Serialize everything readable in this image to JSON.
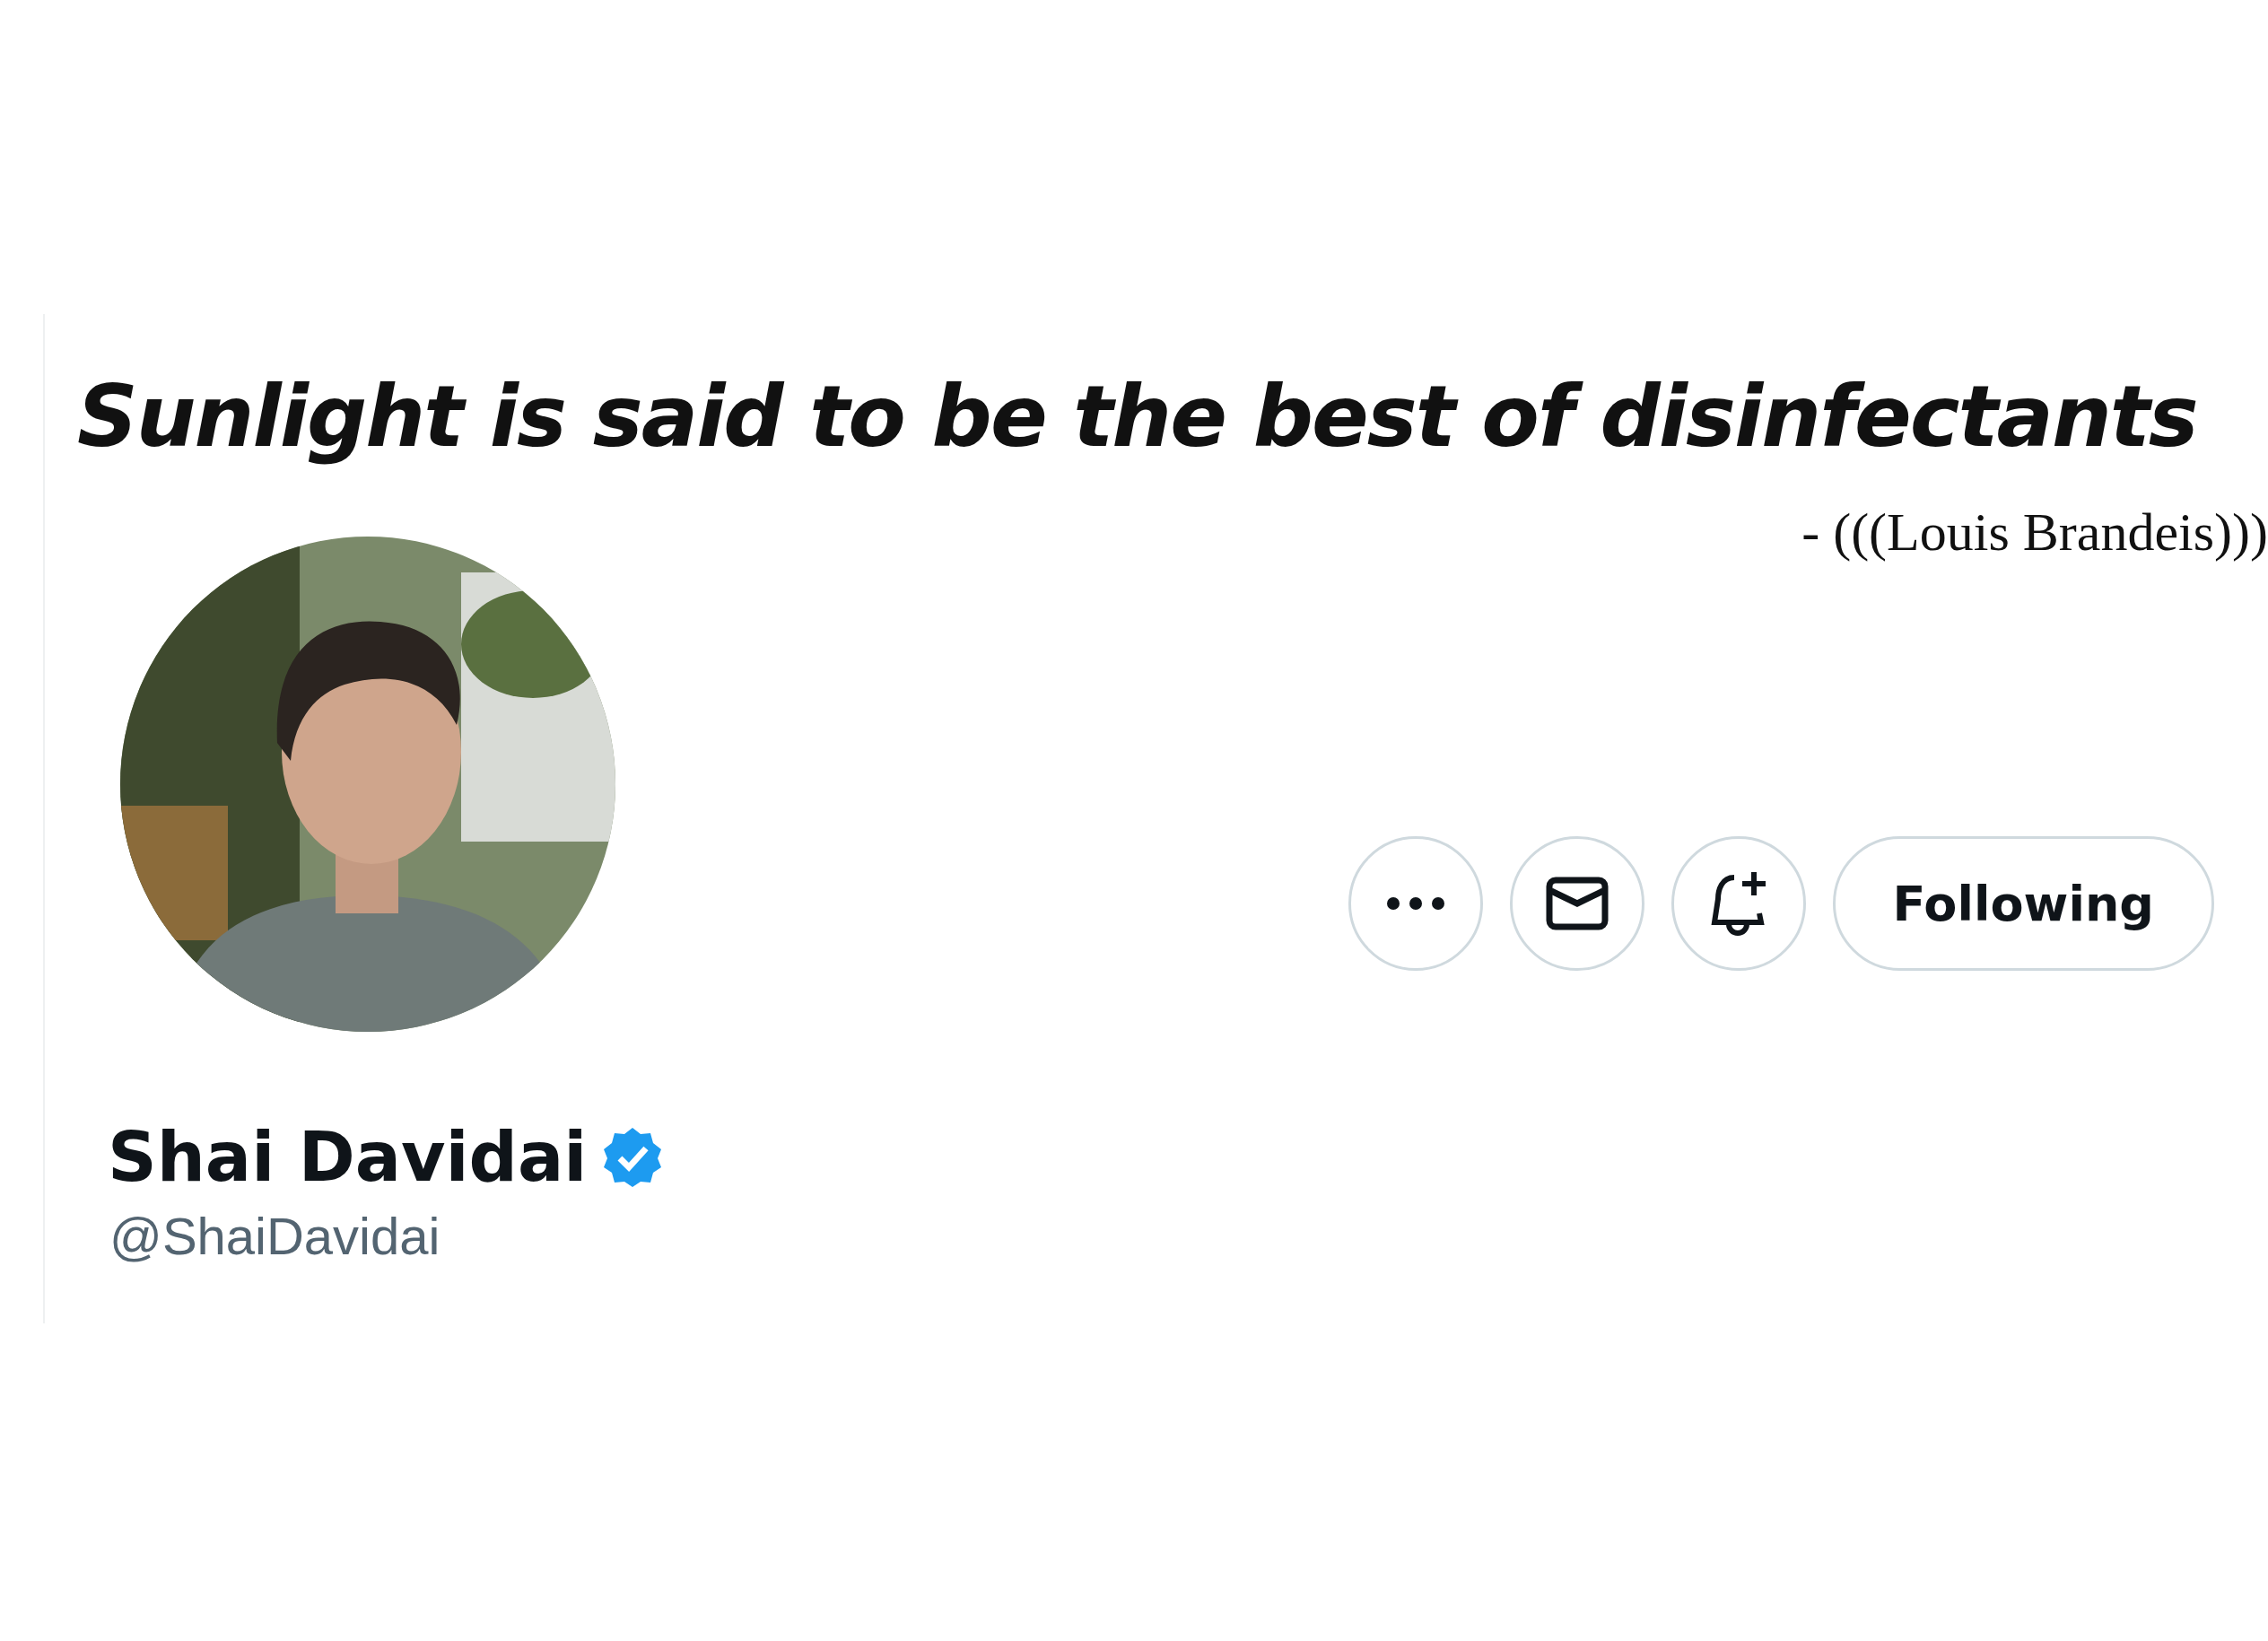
{
  "banner": {
    "quote": "Sunlight is said to be the best of disinfectants",
    "attribution": "- (((Louis Brandeis)))"
  },
  "profile": {
    "name": "Shai Davidai",
    "verified": true,
    "handle": "@ShaiDavidai"
  },
  "actions": [
    {
      "kind": "more"
    },
    {
      "kind": "message"
    },
    {
      "kind": "notify"
    },
    {
      "kind": "follow",
      "label": "Following"
    }
  ]
}
